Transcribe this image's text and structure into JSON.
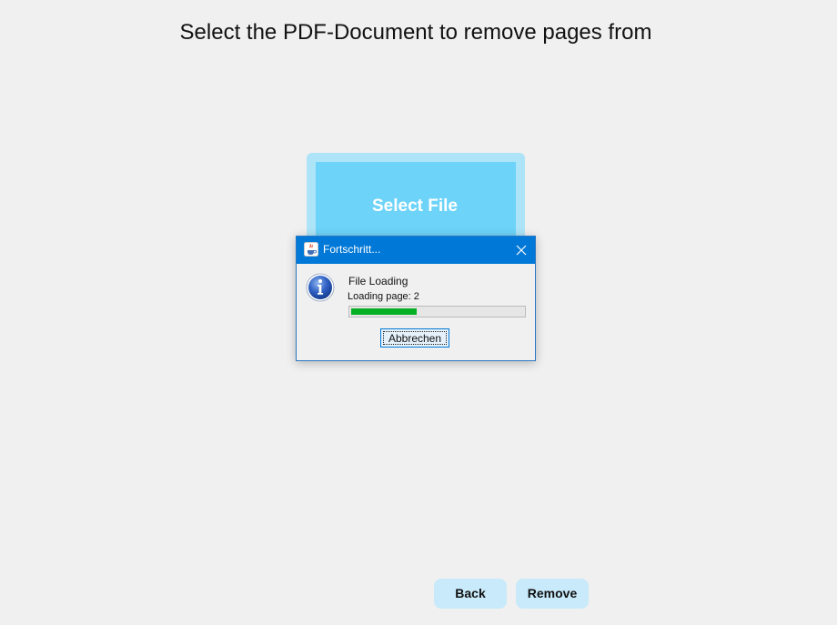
{
  "header": {
    "title": "Select the PDF-Document to remove pages from"
  },
  "select_area": {
    "label": "Select File"
  },
  "dialog": {
    "title": "Fortschritt...",
    "icon": "info-icon",
    "message": "File Loading",
    "status": "Loading page: 2",
    "progress": 0.38,
    "cancel_label": "Abbrechen"
  },
  "footer": {
    "back_label": "Back",
    "remove_label": "Remove"
  },
  "colors": {
    "select_outer": "#aee4f8",
    "select_inner": "#6dd3f8",
    "titlebar": "#0078d7",
    "progress": "#06b025",
    "nav_button": "#c8eafa"
  }
}
